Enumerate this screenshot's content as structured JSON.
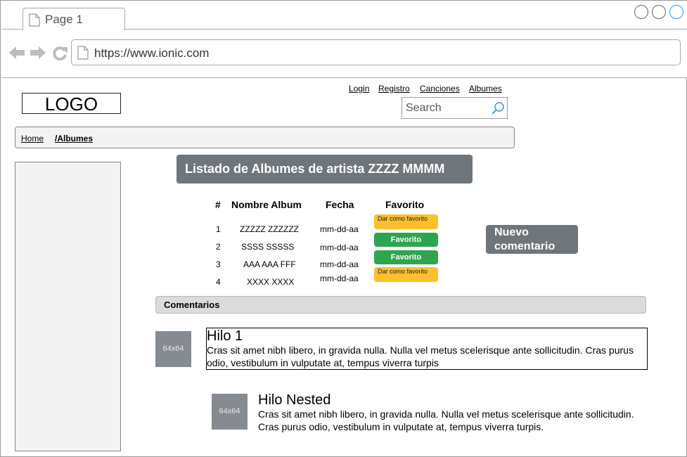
{
  "browser": {
    "tab_title": "Page 1",
    "url": "https://www.ionic.com"
  },
  "header": {
    "logo_text": "LOGO",
    "links": [
      "Login",
      "Registro",
      "Canciones",
      "Albumes"
    ],
    "search_placeholder": "Search"
  },
  "breadcrumb": {
    "home": "Home",
    "current": "/Albumes"
  },
  "main": {
    "heading": "Listado de Albumes de artista ZZZZ MMMM",
    "table": {
      "headers": [
        "#",
        "Nombre Album",
        "Fecha",
        "Favorito"
      ],
      "rows": [
        {
          "num": "1",
          "name": "ZZZZZ ZZZZZZ",
          "date": "mm-dd-aa",
          "fav": "Dar como favorito",
          "fav_state": "warn"
        },
        {
          "num": "2",
          "name": "SSSS SSSSS",
          "date": "mm-dd-aa",
          "fav": "Favorito",
          "fav_state": "ok"
        },
        {
          "num": "3",
          "name": "AAA AAA FFF",
          "date": "mm-dd-aa",
          "fav": "Favorito",
          "fav_state": "ok"
        },
        {
          "num": "4",
          "name": "XXXX XXXX",
          "date": "mm-dd-aa",
          "fav": "Dar como favorito",
          "fav_state": "warn"
        }
      ]
    },
    "nuevo_comentario": "Nuevo comentario",
    "comentarios_title": "Comentarios",
    "threads": [
      {
        "thumb": "64x64",
        "title": "Hilo 1",
        "text": "Cras sit amet nibh libero, in gravida nulla. Nulla vel metus scelerisque ante sollicitudin. Cras purus odio, vestibulum in vulputate at, tempus viverra turpis"
      },
      {
        "thumb": "64x64",
        "title": "Hilo Nested",
        "text": "Cras sit amet nibh libero, in gravida nulla. Nulla vel metus scelerisque ante sollicitudin. Cras purus odio, vestibulum in vulputate at, tempus viverra turpis."
      }
    ]
  },
  "colors": {
    "accent_dark": "#6e757b",
    "warning": "#fdbf2d",
    "success": "#2fa44f"
  }
}
